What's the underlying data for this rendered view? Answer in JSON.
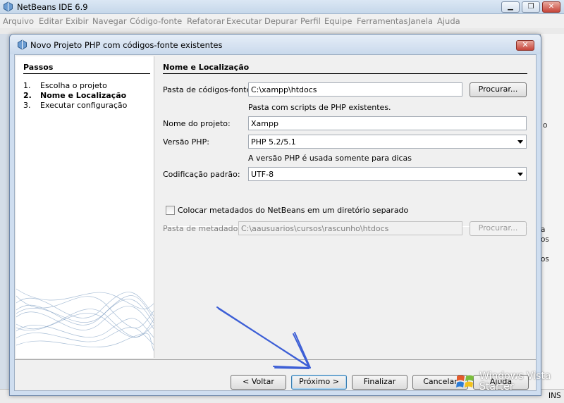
{
  "ide": {
    "title": "NetBeans IDE 6.9",
    "menu": [
      "Arquivo",
      "Editar",
      "Exibir",
      "Navegar",
      "Código-fonte",
      "Refatorar",
      "Executar",
      "Depurar",
      "Perfil",
      "Equipe",
      "Ferramentas",
      "Janela",
      "Ajuda"
    ],
    "right_fragments": [
      "o",
      "a",
      "os",
      "os"
    ],
    "status": "INS"
  },
  "dialog": {
    "title": "Novo Projeto PHP com códigos-fonte existentes",
    "steps_title": "Passos",
    "steps": [
      {
        "num": "1.",
        "label": "Escolha o projeto"
      },
      {
        "num": "2.",
        "label": "Nome e Localização"
      },
      {
        "num": "3.",
        "label": "Executar configuração"
      }
    ],
    "section_title": "Nome e Localização",
    "source_label": "Pasta de códigos-fonte:",
    "source_value": "C:\\xampp\\htdocs",
    "browse_label": "Procurar...",
    "source_hint": "Pasta com scripts de PHP existentes.",
    "project_name_label": "Nome do projeto:",
    "project_name_value": "Xampp",
    "php_version_label": "Versão PHP:",
    "php_version_value": "PHP 5.2/5.1",
    "php_version_hint": "A versão PHP é usada somente para dicas",
    "encoding_label": "Codificação padrão:",
    "encoding_value": "UTF-8",
    "metadata_checkbox_label": "Colocar metadados do NetBeans em um diretório separado",
    "metadata_label": "Pasta de metadados:",
    "metadata_value": "C:\\aausuarios\\cursos\\rascunho\\htdocs",
    "metadata_browse_label": "Procurar...",
    "buttons": {
      "back": "< Voltar",
      "next": "Próximo >",
      "finish": "Finalizar",
      "cancel": "Cancelar",
      "help": "Ajuda"
    }
  },
  "watermark": {
    "line1": "Windows Vista",
    "line2": "Starter"
  }
}
